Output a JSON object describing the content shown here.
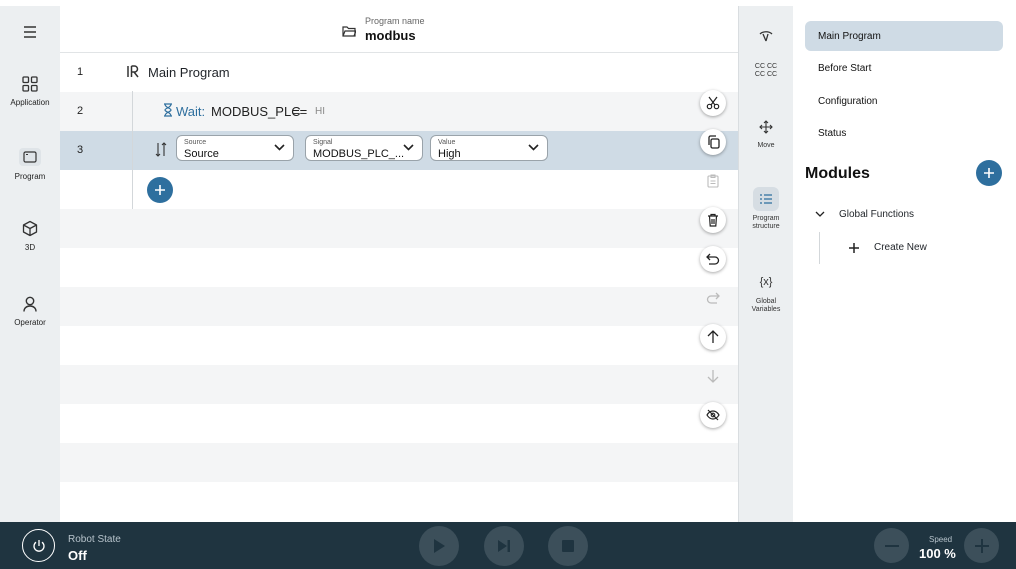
{
  "header": {
    "program_name_label": "Program name",
    "program_name": "modbus"
  },
  "left_nav": {
    "items": [
      {
        "label": "Application",
        "icon": "grid-icon"
      },
      {
        "label": "Program",
        "icon": "screen-icon"
      },
      {
        "label": "3D",
        "icon": "cube-icon"
      },
      {
        "label": "Operator",
        "icon": "person-icon"
      }
    ]
  },
  "program": {
    "rows": [
      {
        "num": "1",
        "text": "Main Program"
      },
      {
        "num": "2",
        "keyword": "Wait:",
        "signal": "MODBUS_PLC",
        "op": "==",
        "value": "HI"
      },
      {
        "num": "3",
        "source_label": "Source",
        "source_value": "Source",
        "signal_label": "Signal",
        "signal_value": "MODBUS_PLC_...",
        "value_label": "Value",
        "value_value": "High"
      }
    ]
  },
  "rail": {
    "items": [
      {
        "label": "cc cc\ncc cc",
        "icon": "robot-icon"
      },
      {
        "label": "Move",
        "icon": "move-icon"
      },
      {
        "label": "Program structure",
        "icon": "list-icon"
      },
      {
        "label": "Global Variables",
        "icon": "variable-icon"
      }
    ],
    "cc_line1": "CC CC",
    "cc_line2": "CC CC",
    "move": "Move",
    "prog_struct_1": "Program",
    "prog_struct_2": "structure",
    "global_1": "Global",
    "global_2": "Variables",
    "var_glyph": "{x}"
  },
  "right_panel": {
    "main_program": "Main Program",
    "before_start": "Before Start",
    "configuration": "Configuration",
    "status": "Status",
    "modules_title": "Modules",
    "global_functions": "Global Functions",
    "create_new": "Create New"
  },
  "bottom_bar": {
    "robot_state_label": "Robot State",
    "robot_state": "Off",
    "speed_label": "Speed",
    "speed_value": "100 %"
  },
  "colors": {
    "accent": "#2e6f9e",
    "bottom_bar": "#1f3440",
    "selected_row": "#cfdbe5"
  }
}
